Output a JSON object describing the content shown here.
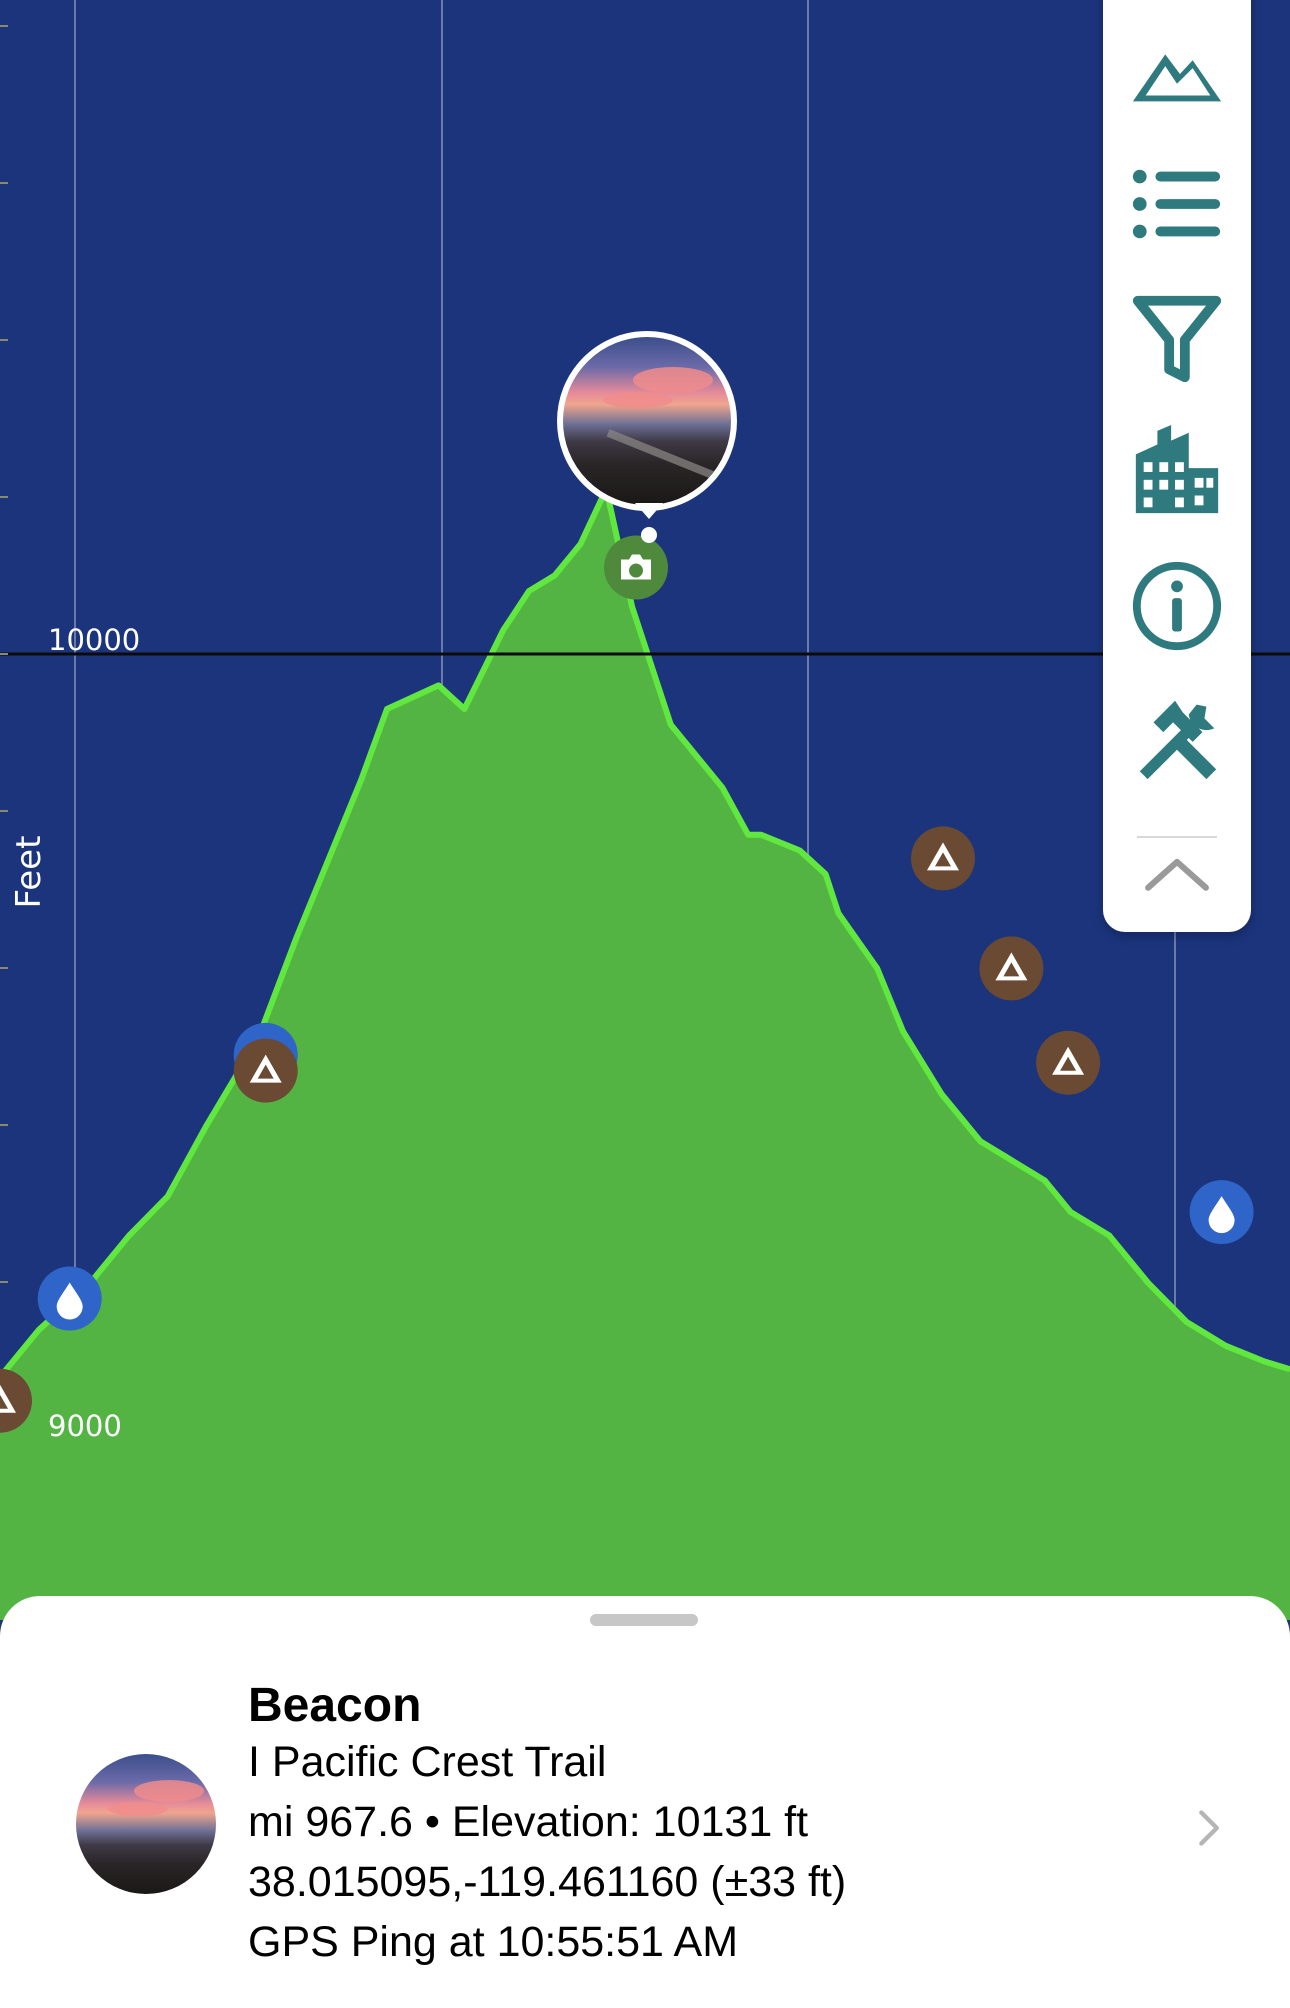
{
  "chart_data": {
    "type": "area",
    "ylabel": "Feet",
    "yticks": [
      10000,
      9000
    ],
    "ylim": [
      8800,
      10800
    ],
    "xlim": [
      0,
      100
    ],
    "series": [
      {
        "x": [
          0,
          3,
          7,
          10,
          13,
          16,
          20,
          23,
          26,
          28,
          30,
          34,
          36,
          39,
          41,
          43,
          45,
          47,
          49,
          52,
          56,
          58,
          59,
          62,
          64,
          65,
          68,
          70,
          73,
          76,
          78,
          81,
          83,
          86,
          89,
          92,
          95,
          98,
          100
        ],
        "values": [
          9080,
          9140,
          9200,
          9260,
          9310,
          9400,
          9510,
          9640,
          9760,
          9840,
          9930,
          9960,
          9930,
          10030,
          10080,
          10100,
          10140,
          10210,
          10060,
          9910,
          9830,
          9770,
          9770,
          9750,
          9720,
          9670,
          9600,
          9520,
          9440,
          9380,
          9360,
          9330,
          9290,
          9260,
          9200,
          9150,
          9120,
          9100,
          9090
        ]
      }
    ],
    "colors": {
      "background": "#1b347c",
      "fill": "#54b443",
      "line": "#60e83e"
    },
    "markers": [
      {
        "type": "water",
        "icon": "water-drop-icon",
        "x": 5.4,
        "y": 9180
      },
      {
        "type": "water",
        "icon": "water-drop-icon",
        "x": 20.6,
        "y": 9490
      },
      {
        "type": "camp",
        "icon": "tent-icon",
        "x": 20.6,
        "y": 9470
      },
      {
        "type": "camp",
        "icon": "tent-icon",
        "x": 73.1,
        "y": 9740
      },
      {
        "type": "camp",
        "icon": "tent-icon",
        "x": 78.4,
        "y": 9600
      },
      {
        "type": "camp",
        "icon": "tent-icon",
        "x": 82.8,
        "y": 9480
      },
      {
        "type": "water",
        "icon": "water-drop-icon",
        "x": 94.7,
        "y": 9290
      },
      {
        "type": "camp",
        "icon": "tent-icon",
        "x": 0.0,
        "y": 9050
      },
      {
        "type": "photo",
        "icon": "camera-icon",
        "x": 49.3,
        "y": 10110
      }
    ]
  },
  "toolbar": {
    "buttons": [
      {
        "name": "elevation-button",
        "icon": "mountain-icon"
      },
      {
        "name": "list-button",
        "icon": "list-icon"
      },
      {
        "name": "filter-button",
        "icon": "filter-icon"
      },
      {
        "name": "towns-button",
        "icon": "buildings-icon"
      },
      {
        "name": "info-button",
        "icon": "info-icon"
      },
      {
        "name": "tools-button",
        "icon": "tools-icon"
      },
      {
        "name": "collapse-button",
        "icon": "chevron-up-icon"
      }
    ],
    "icon_color": "#2e7a7e"
  },
  "waypoint": {
    "title": "Beacon",
    "trail": "I Pacific Crest Trail",
    "mile_elevation": "mi 967.6 • Elevation: 10131 ft",
    "coordinates": "38.015095,-119.461160 (±33 ft)",
    "gps_ping": "GPS Ping at 10:55:51 AM"
  }
}
